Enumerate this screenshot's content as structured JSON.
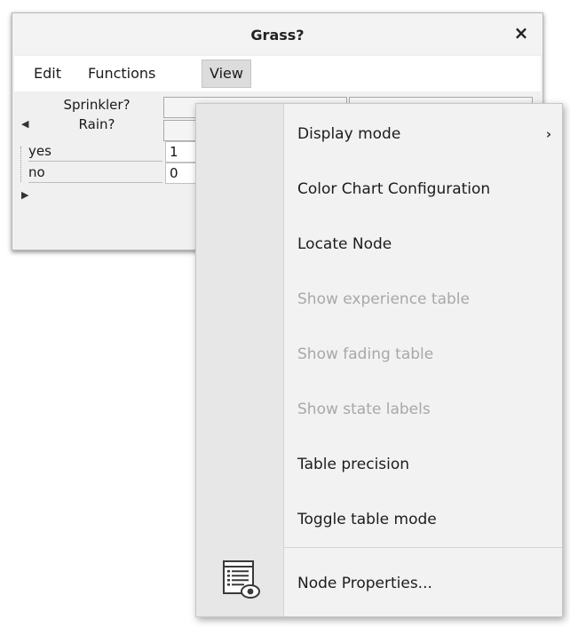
{
  "window": {
    "title": "Grass?",
    "close_glyph": "×",
    "menus": [
      "Edit",
      "Functions",
      "View"
    ],
    "active_menu": "View"
  },
  "table": {
    "header_labels": [
      "Sprinkler?",
      "Rain?"
    ],
    "rows": [
      {
        "label": "yes",
        "value": "1"
      },
      {
        "label": "no",
        "value": "0"
      }
    ]
  },
  "view_menu": {
    "items": [
      {
        "label": "Display mode",
        "enabled": true,
        "submenu": true
      },
      {
        "label": "Color Chart Configuration",
        "enabled": true
      },
      {
        "label": "Locate Node",
        "enabled": true
      },
      {
        "label": "Show experience table",
        "enabled": false
      },
      {
        "label": "Show fading table",
        "enabled": false
      },
      {
        "label": "Show state labels",
        "enabled": false
      },
      {
        "label": "Table precision",
        "enabled": true
      },
      {
        "label": "Toggle table mode",
        "enabled": true
      },
      {
        "label": "Node Properties...",
        "enabled": true,
        "icon": "node-properties-icon"
      }
    ],
    "submenu_glyph": "›"
  }
}
